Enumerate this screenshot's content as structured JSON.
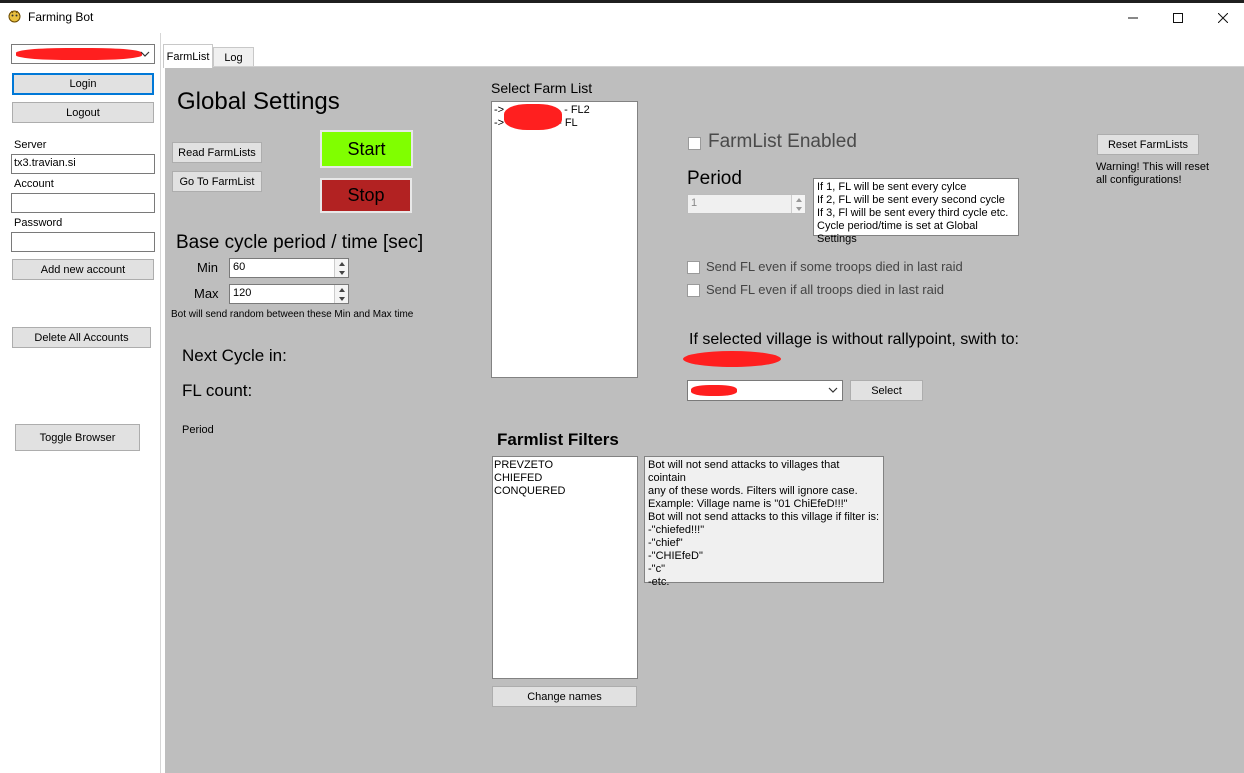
{
  "window": {
    "title": "Farming Bot"
  },
  "left": {
    "account_selected": "",
    "login_label": "Login",
    "logout_label": "Logout",
    "server_label": "Server",
    "server_value": "tx3.travian.si",
    "account_label": "Account",
    "account_value": "",
    "password_label": "Password",
    "password_value": "",
    "add_account_label": "Add new account",
    "delete_all_label": "Delete All Accounts",
    "toggle_browser_label": "Toggle Browser"
  },
  "tabs": [
    {
      "label": "FarmList"
    },
    {
      "label": "Log"
    }
  ],
  "global": {
    "title": "Global Settings",
    "read_farmlists_label": "Read FarmLists",
    "goto_farmlist_label": "Go To FarmList",
    "start_label": "Start",
    "stop_label": "Stop",
    "base_cycle_title": "Base cycle period / time [sec]",
    "min_label": "Min",
    "min_value": "60",
    "max_label": "Max",
    "max_value": "120",
    "random_note": "Bot will send random between these Min and Max time",
    "next_cycle_label": "Next Cycle in:",
    "fl_count_label": "FL count:",
    "period_label": "Period"
  },
  "farm_list": {
    "title": "Select Farm List",
    "items": [
      {
        "prefix": "->",
        "suffix": "- FL2"
      },
      {
        "prefix": "->",
        "suffix": "- FL"
      }
    ]
  },
  "farmlist_settings": {
    "enabled_label": "FarmList Enabled",
    "period_label": "Period",
    "period_value": "1",
    "period_help": [
      "If 1, FL will be sent every cylce",
      "If 2, FL will be sent every second cycle",
      "If 3, Fl will be sent every third cycle etc.",
      "Cycle period/time is set at Global Settings"
    ],
    "send_some_died_label": "Send FL even if some troops died in last raid",
    "send_all_died_label": "Send FL even if all troops died in last raid",
    "rallypoint_label": "If selected village is without rallypoint, swith to:",
    "village_selected": "",
    "select_label": "Select",
    "reset_label": "Reset FarmLists",
    "reset_warning_1": "Warning! This will reset",
    "reset_warning_2": "all configurations!"
  },
  "filters": {
    "title": "Farmlist Filters",
    "items": [
      "PREVZETO",
      "CHIEFED",
      "CONQUERED"
    ],
    "help": [
      "Bot will not send attacks to villages that cointain",
      "any of these words. Filters will ignore case.",
      "Example: Village name is \"01 ChiEfeD!!!\"",
      "Bot will not send attacks to this village if filter is:",
      "-\"chiefed!!!\"",
      "-\"chief\"",
      "-\"CHIEfeD\"",
      "-\"c\"",
      "-etc."
    ],
    "change_names_label": "Change names"
  },
  "colors": {
    "start_bg": "#80ff00",
    "stop_bg": "#b22222",
    "content_bg": "#bebebe",
    "redaction": "#ff1f1f"
  }
}
